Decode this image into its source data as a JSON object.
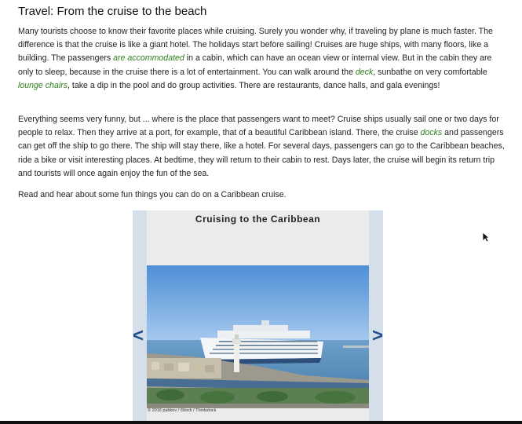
{
  "page_title": "Travel: From the cruise to the beach",
  "paragraph1": {
    "t1": "Many tourists choose to know their favorite places while cruising. Surely you wonder why, if traveling by plane is much faster. The difference is that the cruise is like a giant hotel. The holidays start before sailing! Cruises are huge ships, with many floors, like a building. The passengers ",
    "h1": "are accommodated",
    "t2": " in a cabin, which can have an ocean view or internal view. But in the cabin they are only to sleep, because in the cruise there is a lot of entertainment. You can walk around the ",
    "h2": "deck",
    "t3": ", sunbathe on very comfortable ",
    "h3": "lounge chairs",
    "t4": ", take a dip in the pool and do group activities. There are restaurants, dance halls, and gala evenings!"
  },
  "paragraph2": {
    "t1": "Everything seems very funny, but ... where is the place that passengers want to meet? Cruise ships usually sail one or two days for people to relax. Then they arrive at a port, for example, that of a beautiful Caribbean island. There, the cruise ",
    "h1": "docks",
    "t2": " and passengers can get off the ship to go there. The ship will stay there, like a hotel. For several days, passengers can go to the Caribbean beaches, ride a bike or visit interesting places. At bedtime, they will return to their cabin to rest. Days later, the cruise will begin its return trip and tourists will once again enjoy the fun of the sea."
  },
  "paragraph3": "Read and hear about some fun things you can do on a Caribbean cruise.",
  "slideshow": {
    "title": "Cruising to the Caribbean",
    "credit": "© 2016 pabkov / iStock / Thinkstock",
    "prev_label": "<",
    "next_label": ">"
  },
  "colors": {
    "highlight": "#2e7d1e",
    "side_bar": "#d5dfe9",
    "arrow": "#1f4f8c"
  },
  "icons": {
    "prev": "chevron-left-icon",
    "next": "chevron-right-icon",
    "cursor": "mouse-pointer-icon"
  }
}
